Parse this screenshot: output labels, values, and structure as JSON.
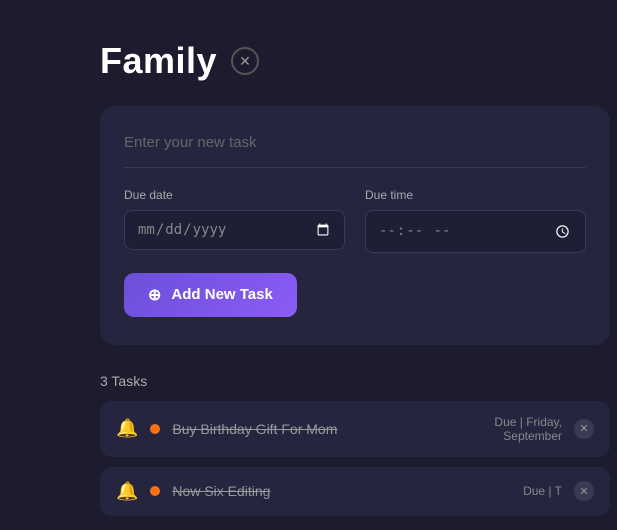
{
  "page": {
    "background_color": "#1c1c2e"
  },
  "header": {
    "title": "Family",
    "close_icon": "✕"
  },
  "form": {
    "task_input_placeholder": "Enter your new task",
    "due_date_label": "Due date",
    "due_date_placeholder": "mm/dd/yyyy",
    "due_time_label": "Due time",
    "due_time_placeholder": "--:-- --",
    "add_button_label": "Add New Task",
    "add_button_icon": "⊕"
  },
  "tasks": {
    "count_label": "3 Tasks",
    "items": [
      {
        "id": 1,
        "text": "Buy Birthday Gift For Mom",
        "due": "Due | Friday,",
        "due_detail": "September",
        "completed": true
      },
      {
        "id": 2,
        "text": "Now Six Editing",
        "due": "Due | T",
        "due_detail": "",
        "completed": true
      }
    ]
  },
  "icons": {
    "alarm": "🔔",
    "close": "✕",
    "add_task": "⊕"
  }
}
